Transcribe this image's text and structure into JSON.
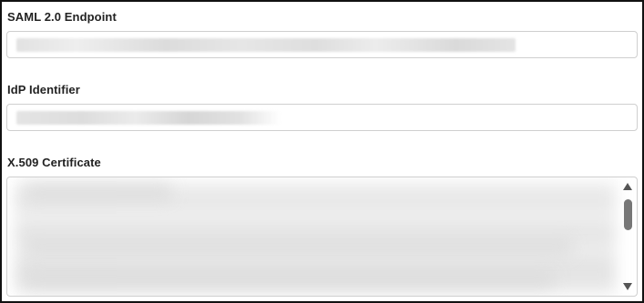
{
  "saml_endpoint": {
    "label": "SAML 2.0 Endpoint",
    "value_state": "redacted"
  },
  "idp_identifier": {
    "label": "IdP Identifier",
    "value_state": "redacted"
  },
  "x509_certificate": {
    "label": "X.509 Certificate",
    "value_state": "redacted",
    "scroll_position": 0.05
  },
  "colors": {
    "label_text": "#222222",
    "field_border": "#cfcfcf",
    "frame_border": "#111111",
    "scroll_thumb": "#777777"
  },
  "icons": {
    "scroll_up": "triangle-up",
    "scroll_down": "triangle-down"
  }
}
